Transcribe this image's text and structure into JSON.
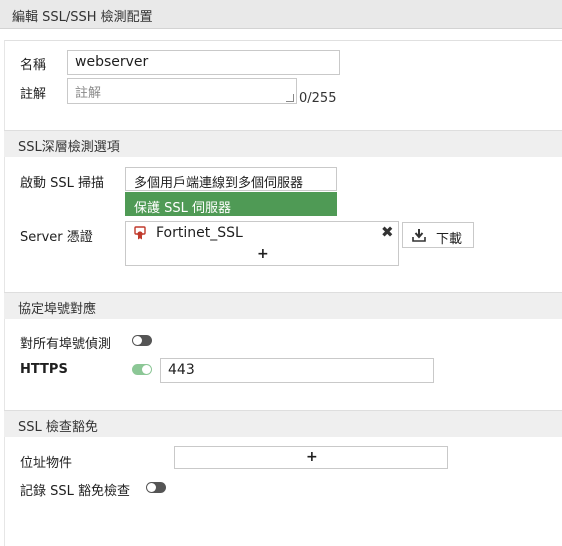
{
  "window": {
    "title": "編輯 SSL/SSH 檢測配置"
  },
  "general": {
    "name_label": "名稱",
    "name_value": "webserver",
    "comment_label": "註解",
    "comment_placeholder": "註解",
    "comment_counter": "0/255"
  },
  "ssl_inspection": {
    "section_title": "SSL深層檢測選項",
    "enable_label": "啟動 SSL 掃描",
    "options": [
      {
        "label": "多個用戶端連線到多個伺服器",
        "selected": false
      },
      {
        "label": "保護 SSL 伺服器",
        "selected": true
      }
    ],
    "server_cert_label": "Server 憑證",
    "cert_name": "Fortinet_SSL",
    "add_symbol": "+",
    "download_label": "下載"
  },
  "port_mapping": {
    "section_title": "協定埠號對應",
    "inspect_all_label": "對所有埠號偵測",
    "inspect_all_enabled": false,
    "https_label": "HTTPS",
    "https_enabled": true,
    "https_port": "443"
  },
  "exemption": {
    "section_title": "SSL 檢查豁免",
    "address_label": "位址物件",
    "add_symbol": "+",
    "log_label": "記錄 SSL 豁免檢查",
    "log_enabled": false
  },
  "colors": {
    "selected_option": "#4f9a55",
    "toggle_on": "#8cc796",
    "toggle_off": "#555555",
    "cert_icon": "#c0392b"
  },
  "icons": {
    "certificate": "certificate-icon",
    "remove": "close-icon",
    "download": "download-icon",
    "add": "plus-icon"
  }
}
